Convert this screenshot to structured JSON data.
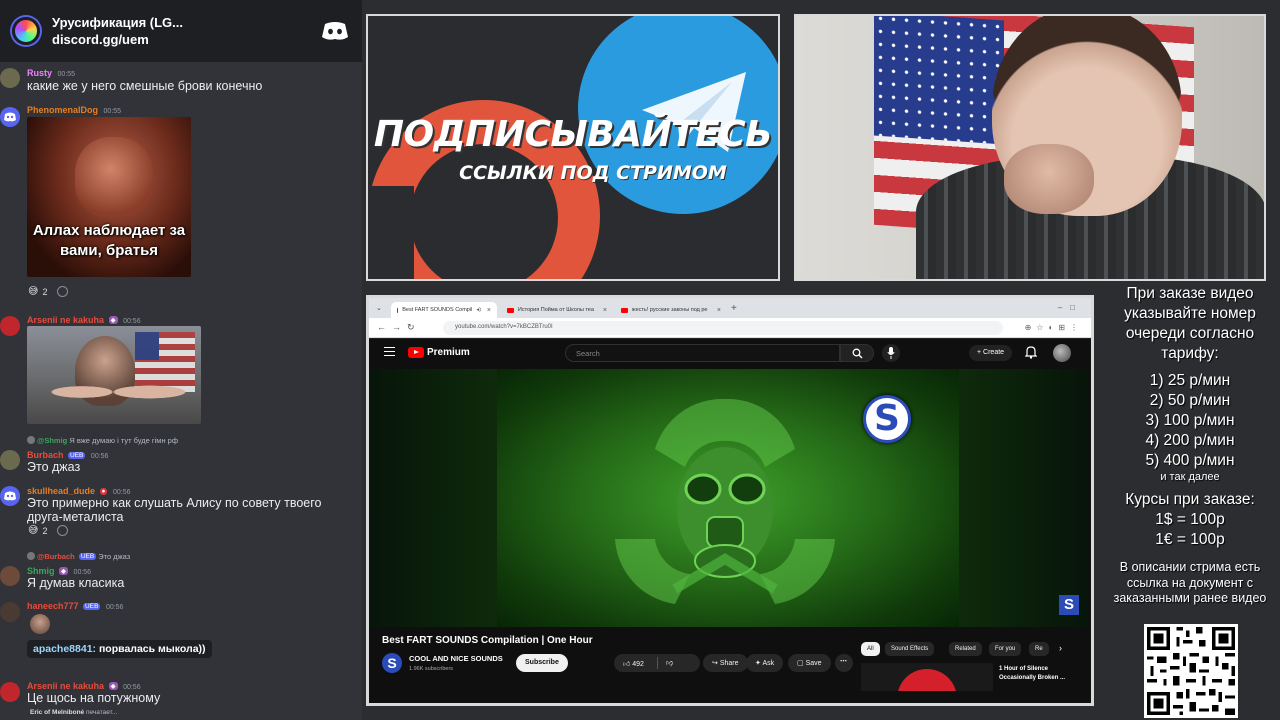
{
  "discord": {
    "server_name": "Урусификация (LG...",
    "invite": "discord.gg/uem",
    "messages": [
      {
        "user": "Rusty",
        "time": "00:55",
        "text": "какие же у него смешные брови конечно",
        "color": "#f47fff"
      },
      {
        "user": "PhenomenalDog",
        "time": "00:55",
        "image_caption": "Аллах наблюдает за вами, братья",
        "reaction_count": "2",
        "color": "#e67e22"
      },
      {
        "user": "Arsenii ne kakuha",
        "time": "00:56",
        "color": "#e74c3c"
      },
      {
        "reply_user": "@Shmig",
        "reply_text": "Я вже думаю і тут буде гімн рф",
        "user": "Burbach",
        "badge": "UEB",
        "time": "00:56",
        "text": "Это джаз",
        "color": "#e74c3c"
      },
      {
        "user": "skullhead_dude",
        "time": "00:56",
        "text": "Это примерно как слушать Алису по совету твоего друга-металиста",
        "reaction_count": "2",
        "color": "#e67e22"
      },
      {
        "reply_user": "@Burbach",
        "reply_badge": "UEB",
        "reply_text": "Это джаз",
        "user": "Shmig",
        "time": "00:56",
        "text": "Я думав класика",
        "color": "#3ba55d"
      },
      {
        "user": "haneech777",
        "badge": "UEB",
        "time": "00:56",
        "quote_user": "apache8841:",
        "quote_text": "порвалась мыкола))",
        "color": "#e74c3c"
      },
      {
        "user": "Arsenii ne kakuha",
        "time": "00:56",
        "text": "Це щось на потужному",
        "color": "#e74c3c"
      }
    ],
    "typing": {
      "user": "Eric of Melniboné",
      "suffix": "печатает..."
    }
  },
  "promo": {
    "title": "ПОДПИСЫВАЙТЕСЬ",
    "subtitle": "ССЫЛКИ ПОД СТРИМОМ"
  },
  "browser": {
    "tabs": [
      {
        "label": "Best FART SOUNDS Compil",
        "active": true
      },
      {
        "label": "История Пойма от Школы теа",
        "active": false
      },
      {
        "label": "жесть! русские законы под ре",
        "active": false
      }
    ],
    "url": "youtube.com/watch?v=7kBCZBTru0I"
  },
  "youtube": {
    "logo_text": "Premium",
    "search_placeholder": "Search",
    "create_label": "Create",
    "video_title": "Best FART SOUNDS Compilation | One Hour",
    "channel_name": "COOL AND NICE SOUNDS",
    "subscribers": "1.96K subscribers",
    "subscribe_label": "Subscribe",
    "likes": "492",
    "share_label": "Share",
    "ask_label": "Ask",
    "save_label": "Save",
    "chips": [
      "All",
      "Sound Effects",
      "Related",
      "For you",
      "Re"
    ],
    "rec_title": "1 Hour of Silence Occasionally Broken ..."
  },
  "info": {
    "order_note": "При заказе видео указывайте номер очереди согласно тарифу:",
    "tariffs": [
      "1) 25 р/мин",
      "2) 50 р/мин",
      "3) 100 р/мин",
      "4) 200 р/мин",
      "5) 400 р/мин"
    ],
    "etc": "и так далее",
    "rates_title": "Курсы при заказе:",
    "rates": [
      "1$ = 100р",
      "1€ = 100р"
    ],
    "doc_note": "В описании стрима есть ссылка на документ с заказанными ранее видео"
  }
}
